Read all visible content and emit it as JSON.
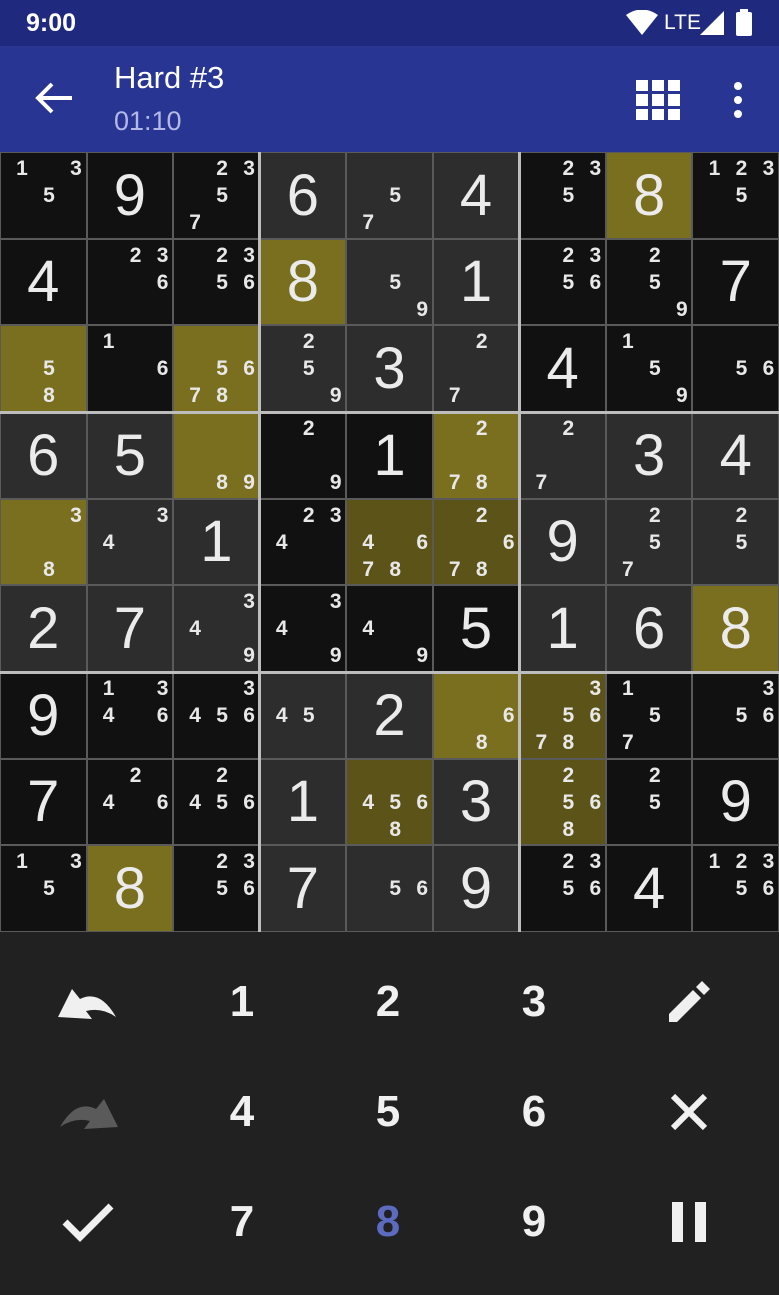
{
  "status_bar": {
    "time": "9:00",
    "network": "LTE"
  },
  "header": {
    "title": "Hard #3",
    "timer": "01:10"
  },
  "icons": {
    "back": "arrow-back-icon",
    "board_view": "grid-view-icon",
    "menu": "more-vert-icon"
  },
  "colors": {
    "status_bar": "#1f2a7e",
    "app_bar": "#283593",
    "highlight": "#7a6e1f",
    "active_digit": "#5c6bc0"
  },
  "board": [
    [
      {
        "c": [
          1,
          3,
          5
        ]
      },
      {
        "v": "9"
      },
      {
        "c": [
          2,
          3,
          5,
          7
        ]
      },
      {
        "v": "6"
      },
      {
        "c": [
          5,
          7
        ]
      },
      {
        "v": "4"
      },
      {
        "c": [
          2,
          3,
          5
        ]
      },
      {
        "v": "8"
      },
      {
        "c": [
          1,
          2,
          3,
          5
        ]
      }
    ],
    [
      {
        "v": "4"
      },
      {
        "c": [
          2,
          3,
          6
        ]
      },
      {
        "c": [
          2,
          3,
          5,
          6
        ]
      },
      {
        "v": "8"
      },
      {
        "c": [
          5,
          9
        ]
      },
      {
        "v": "1"
      },
      {
        "c": [
          2,
          3,
          5,
          6
        ]
      },
      {
        "c": [
          2,
          5,
          9
        ]
      },
      {
        "v": "7"
      }
    ],
    [
      {
        "c": [
          5,
          8
        ]
      },
      {
        "c": [
          1,
          6
        ]
      },
      {
        "c": [
          5,
          6,
          7,
          8
        ]
      },
      {
        "c": [
          2,
          5,
          9
        ]
      },
      {
        "v": "3"
      },
      {
        "c": [
          2,
          7
        ]
      },
      {
        "v": "4"
      },
      {
        "c": [
          1,
          5,
          9
        ]
      },
      {
        "c": [
          5,
          6
        ]
      }
    ],
    [
      {
        "v": "6"
      },
      {
        "v": "5"
      },
      {
        "c": [
          8,
          9
        ]
      },
      {
        "c": [
          2,
          9
        ]
      },
      {
        "v": "1"
      },
      {
        "c": [
          2,
          7,
          8
        ]
      },
      {
        "c": [
          2,
          7
        ]
      },
      {
        "v": "3"
      },
      {
        "v": "4"
      }
    ],
    [
      {
        "c": [
          3,
          8
        ]
      },
      {
        "c": [
          3,
          4
        ]
      },
      {
        "v": "1"
      },
      {
        "c": [
          2,
          3,
          4
        ]
      },
      {
        "c": [
          4,
          6,
          7,
          8
        ]
      },
      {
        "c": [
          2,
          6,
          7,
          8
        ]
      },
      {
        "v": "9"
      },
      {
        "c": [
          2,
          5,
          7
        ]
      },
      {
        "c": [
          2,
          5
        ]
      }
    ],
    [
      {
        "v": "2"
      },
      {
        "v": "7"
      },
      {
        "c": [
          3,
          4,
          9
        ]
      },
      {
        "c": [
          3,
          4,
          9
        ]
      },
      {
        "c": [
          4,
          9
        ]
      },
      {
        "v": "5"
      },
      {
        "v": "1"
      },
      {
        "v": "6"
      },
      {
        "v": "8"
      }
    ],
    [
      {
        "v": "9"
      },
      {
        "c": [
          1,
          3,
          4,
          6
        ]
      },
      {
        "c": [
          3,
          4,
          5,
          6
        ]
      },
      {
        "c": [
          4,
          5
        ]
      },
      {
        "v": "2"
      },
      {
        "c": [
          6,
          8
        ]
      },
      {
        "c": [
          3,
          5,
          6,
          7,
          8
        ]
      },
      {
        "c": [
          1,
          5,
          7
        ]
      },
      {
        "c": [
          3,
          5,
          6
        ]
      }
    ],
    [
      {
        "v": "7"
      },
      {
        "c": [
          2,
          4,
          6
        ]
      },
      {
        "c": [
          2,
          4,
          5,
          6
        ]
      },
      {
        "v": "1"
      },
      {
        "c": [
          4,
          5,
          6,
          8
        ]
      },
      {
        "v": "3"
      },
      {
        "c": [
          2,
          5,
          6,
          8
        ]
      },
      {
        "c": [
          2,
          5
        ]
      },
      {
        "v": "9"
      }
    ],
    [
      {
        "c": [
          1,
          3,
          5
        ]
      },
      {
        "v": "8"
      },
      {
        "c": [
          2,
          3,
          5,
          6
        ]
      },
      {
        "v": "7"
      },
      {
        "c": [
          5,
          6
        ]
      },
      {
        "v": "9"
      },
      {
        "c": [
          2,
          3,
          5,
          6
        ]
      },
      {
        "v": "4"
      },
      {
        "c": [
          1,
          2,
          3,
          5,
          6
        ]
      }
    ]
  ],
  "highlighted_cells": [
    [
      0,
      7
    ],
    [
      1,
      3
    ],
    [
      2,
      0
    ],
    [
      2,
      2
    ],
    [
      3,
      2
    ],
    [
      3,
      5
    ],
    [
      4,
      0
    ],
    [
      4,
      4
    ],
    [
      4,
      5
    ],
    [
      5,
      8
    ],
    [
      6,
      5
    ],
    [
      6,
      6
    ],
    [
      7,
      4
    ],
    [
      7,
      6
    ],
    [
      8,
      1
    ]
  ],
  "keypad": {
    "digits": [
      "1",
      "2",
      "3",
      "4",
      "5",
      "6",
      "7",
      "8",
      "9"
    ],
    "active_digit": "8",
    "undo_icon": "undo-icon",
    "redo_icon": "redo-icon",
    "pencil_icon": "pencil-icon",
    "erase_icon": "close-icon",
    "check_icon": "check-icon",
    "pause_icon": "pause-icon"
  }
}
